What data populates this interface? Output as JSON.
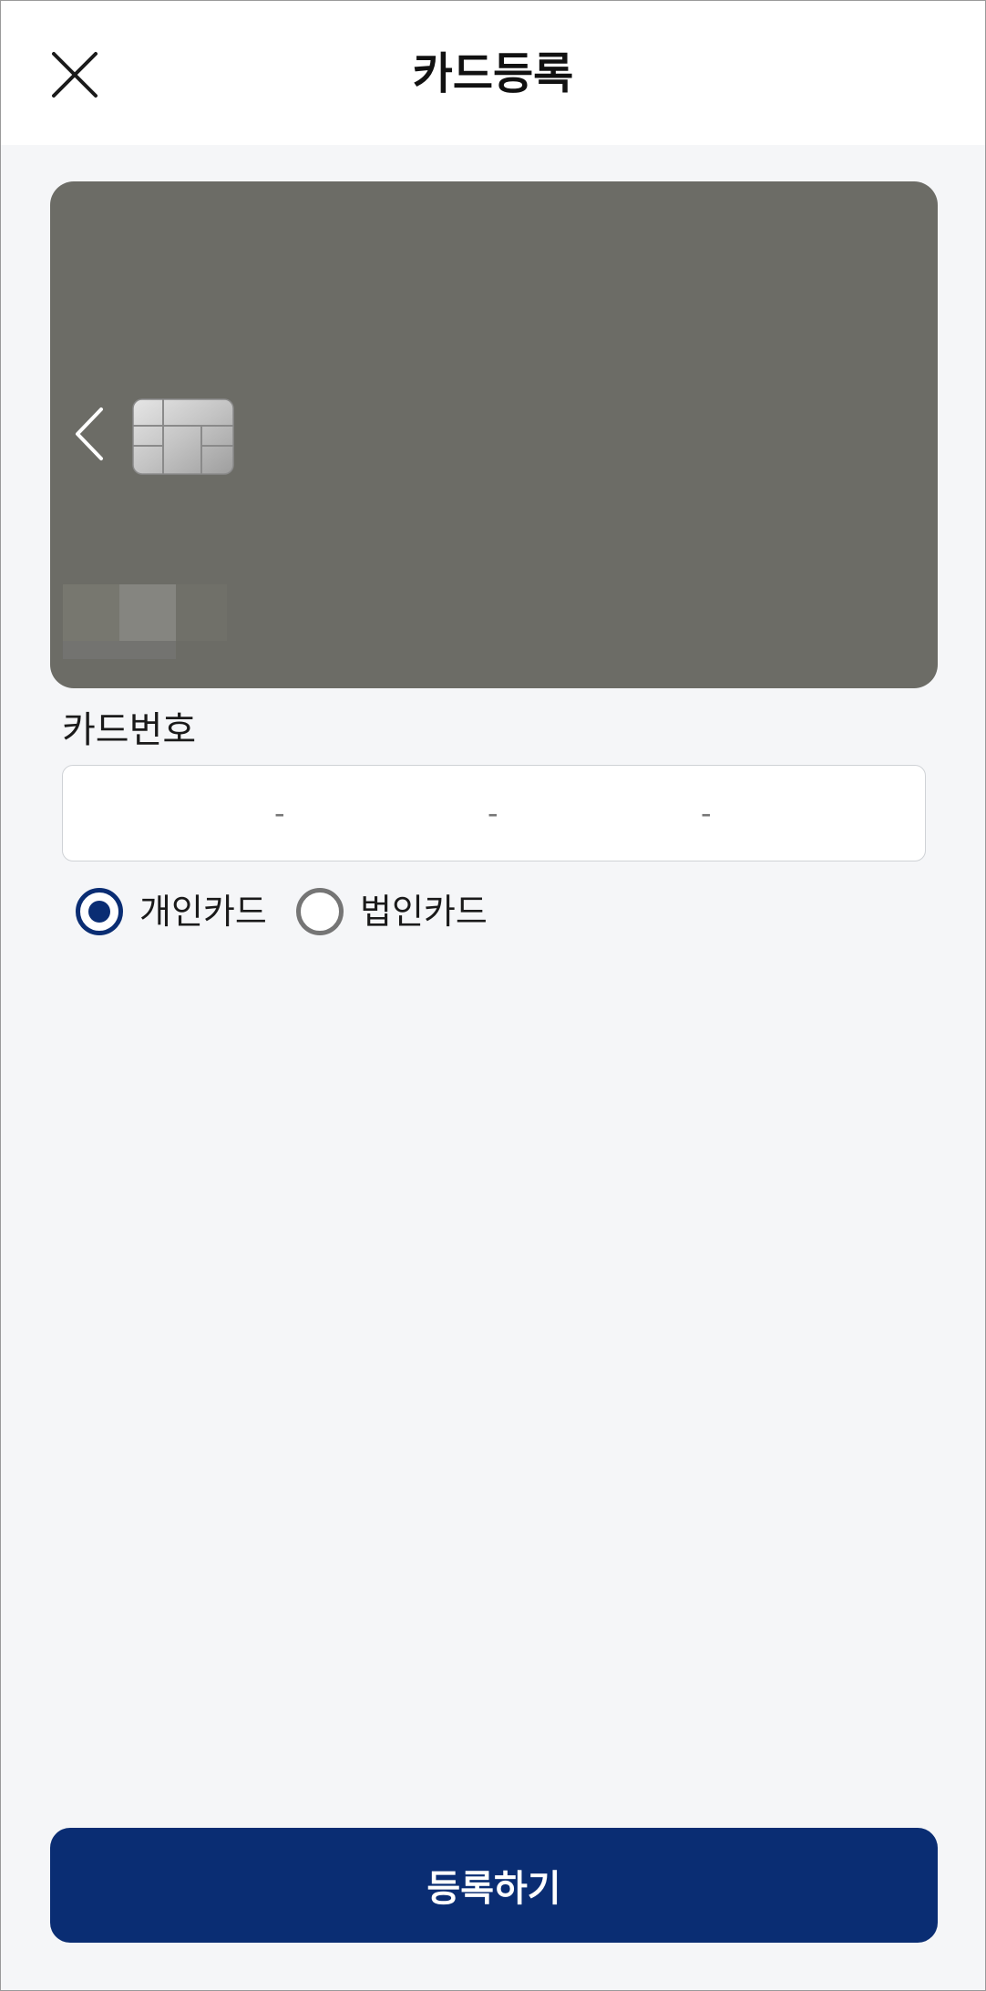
{
  "header": {
    "title": "카드등록",
    "close_icon": "close-icon"
  },
  "card_preview": {
    "background_color": "#6c6c66",
    "prev_icon": "chevron-left-icon",
    "chip_icon": "card-chip-icon"
  },
  "card_number": {
    "label": "카드번호",
    "separator": "-",
    "segments": [
      "",
      "",
      "",
      ""
    ]
  },
  "card_type": {
    "options": [
      {
        "label": "개인카드",
        "checked": true
      },
      {
        "label": "법인카드",
        "checked": false
      }
    ]
  },
  "submit": {
    "label": "등록하기"
  },
  "colors": {
    "primary": "#0a2d73",
    "page_background": "#f5f6f8",
    "radio_unchecked": "#757575"
  }
}
